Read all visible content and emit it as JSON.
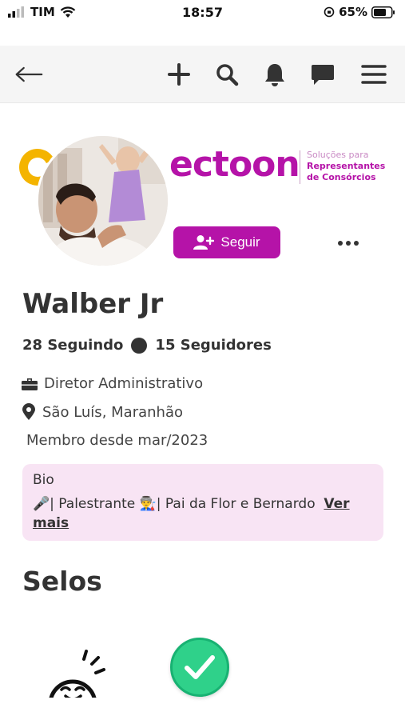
{
  "status_bar": {
    "carrier": "TIM",
    "time": "18:57",
    "battery": "65%"
  },
  "nav": {
    "icons": [
      "back-arrow-icon",
      "plus-icon",
      "search-icon",
      "bell-icon",
      "chat-icon",
      "menu-icon"
    ]
  },
  "brand": {
    "logo_text": "ectoon",
    "tagline_1": "Soluções para",
    "tagline_2": "Representantes",
    "tagline_3": "de Consórcios",
    "primary_color": "#b513a8",
    "accent_color": "#f4b400"
  },
  "profile": {
    "follow_label": "Seguir",
    "name": "Walber Jr",
    "following": "28 Seguindo",
    "followers": "15 Seguidores",
    "job_title": "Diretor Administrativo",
    "location": "São Luís, Maranhão",
    "member_since": "Membro desde mar/2023"
  },
  "bio": {
    "title": "Bio",
    "text": "🎤| Palestrante 👨‍🏭| Pai da Flor e Bernardo",
    "more_label": "Ver mais"
  },
  "badges": {
    "title": "Selos",
    "items": [
      "sun-face-badge-icon",
      "check-badge-icon"
    ]
  }
}
